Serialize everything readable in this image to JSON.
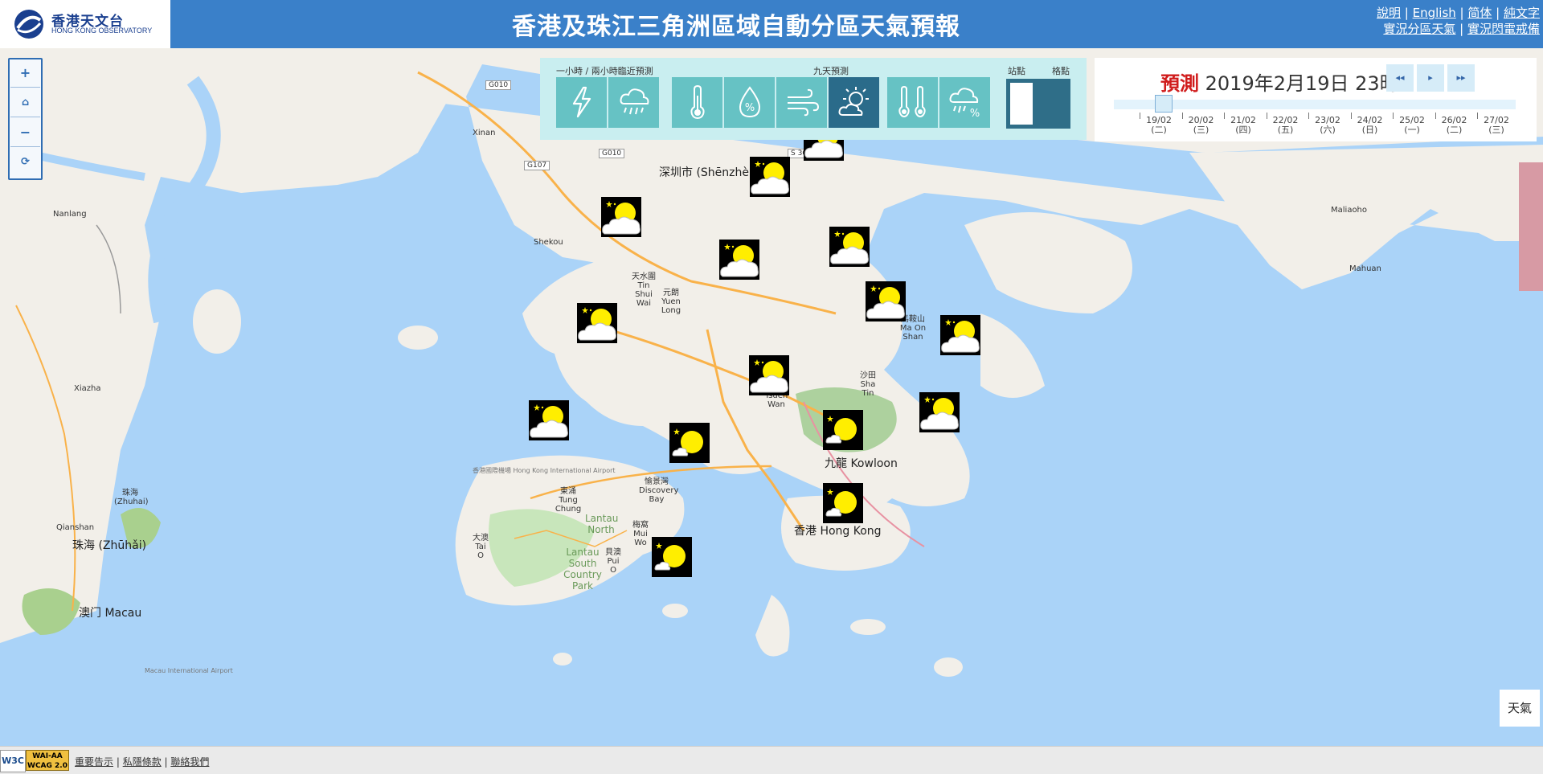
{
  "header": {
    "logo_zh": "香港天文台",
    "logo_en": "HONG KONG OBSERVATORY",
    "title": "香港及珠江三角洲區域自動分區天氣預報",
    "links_row1": [
      "說明",
      "English",
      "简体",
      "純文字"
    ],
    "links_row2": [
      "實況分區天氣",
      "實況閃電戒備"
    ]
  },
  "zoom_controls": [
    {
      "label": "+",
      "icon": "zoom-in-icon"
    },
    {
      "label": "⌂",
      "icon": "home-icon"
    },
    {
      "label": "−",
      "icon": "zoom-out-icon"
    },
    {
      "label": "⟳",
      "icon": "refresh-icon"
    }
  ],
  "layer_panel": {
    "group1_label": "一小時 / 兩小時臨近預測",
    "group2_label": "九天預測",
    "station_label": "站點",
    "grid_label": "格點",
    "tiles": [
      {
        "icon": "lightning-icon",
        "active": false
      },
      {
        "icon": "rain-cloud-icon",
        "active": false
      },
      {
        "icon": "thermometer-icon",
        "active": false
      },
      {
        "icon": "humidity-drop-icon",
        "active": false
      },
      {
        "icon": "wind-icon",
        "active": false
      },
      {
        "icon": "sun-cloud-icon",
        "active": true
      },
      {
        "icon": "temperature-range-icon",
        "active": false
      },
      {
        "icon": "rain-probability-icon",
        "active": false
      }
    ]
  },
  "time_panel": {
    "prefix": "預測",
    "time": "2019年2月19日 23時",
    "dates": [
      {
        "date": "19/02",
        "weekday": "(二)"
      },
      {
        "date": "20/02",
        "weekday": "(三)"
      },
      {
        "date": "21/02",
        "weekday": "(四)"
      },
      {
        "date": "22/02",
        "weekday": "(五)"
      },
      {
        "date": "23/02",
        "weekday": "(六)"
      },
      {
        "date": "24/02",
        "weekday": "(日)"
      },
      {
        "date": "25/02",
        "weekday": "(一)"
      },
      {
        "date": "26/02",
        "weekday": "(二)"
      },
      {
        "date": "27/02",
        "weekday": "(三)"
      }
    ],
    "nav_first": "◂◂",
    "nav_next": "▸",
    "nav_last": "▸▸"
  },
  "map_labels": {
    "shenzhen": "深圳市 (Shēnzhèn)",
    "xinan": "Xinan",
    "nanlang": "Nanlang",
    "shekou": "Shekou",
    "xiazha": "Xiazha",
    "zhuhai_small": "珠海 (Zhuhai)",
    "qianshan": "Qianshan",
    "zhuhai": "珠海 (Zhūhǎi)",
    "macau": "澳门 Macau",
    "maliaoho": "Maliaoho",
    "mahuan": "Mahuan",
    "yuen_long": "元朗 Yuen Long",
    "tin_shui_wai": "天水圍 Tin Shui Wai",
    "tsuen_wan": "荃灣 Tsuen Wan",
    "sha_tin": "沙田 Sha Tin",
    "ma_on_shan": "馬鞍山 Ma On Shan",
    "kowloon": "九龍 Kowloon",
    "hong_kong": "香港 Hong Kong",
    "tung_chung": "東涌 Tung Chung",
    "discovery_bay": "愉景灣 Discovery Bay",
    "tai_o": "大澳 Tai O",
    "mui_wo": "梅窩 Mui Wo",
    "pui_o": "貝澳 Pui O",
    "lantau_north": "Lantau North",
    "lantau_south": "Lantau South Country Park",
    "airport_hk": "香港國際機場 Hong Kong International Airport",
    "airport_macau": "Macau International Airport",
    "g010_a": "G010",
    "g010_b": "G010",
    "g107": "G107",
    "s360": "S 360"
  },
  "weather_icons": [
    {
      "type": "night-sunny-periods"
    },
    {
      "type": "night-sunny-periods"
    },
    {
      "type": "night-sunny-periods"
    },
    {
      "type": "night-sunny-periods"
    },
    {
      "type": "night-sunny-periods"
    },
    {
      "type": "night-sunny-periods"
    },
    {
      "type": "night-sunny-periods"
    },
    {
      "type": "night-sunny-periods"
    },
    {
      "type": "night-sunny-periods"
    },
    {
      "type": "night-sunny-periods"
    },
    {
      "type": "night-sunny-periods"
    },
    {
      "type": "night-mainly-fine"
    },
    {
      "type": "night-mainly-fine"
    },
    {
      "type": "night-mainly-fine"
    },
    {
      "type": "night-mainly-fine"
    }
  ],
  "legend_button": "天氣",
  "footer": {
    "w3c": "W3C",
    "wcag_line1": "WAI-AA",
    "wcag_line2": "WCAG 2.0",
    "links": [
      "重要告示",
      "私隱條款",
      "聯絡我們"
    ]
  },
  "colors": {
    "header_blue": "#3a80c9",
    "sea": "#aad3f8",
    "land": "#f2efe9",
    "park": "#c8facc",
    "tile": "#66c2c4",
    "tile_active": "#2a6b8a",
    "forecast_red": "#d01c1c"
  }
}
